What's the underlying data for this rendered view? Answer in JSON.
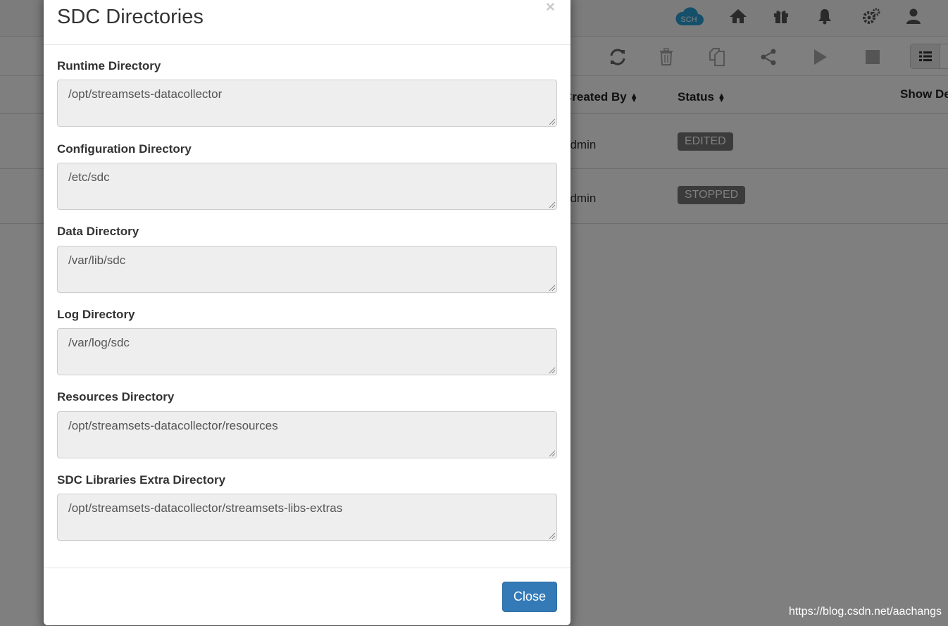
{
  "navbar": {
    "icons": [
      "sch-cloud-icon",
      "home-icon",
      "gift-icon",
      "bell-icon",
      "gears-icon",
      "user-icon"
    ],
    "sch_label": "SCH",
    "accent": "#2aa0d6"
  },
  "toolbar": {
    "icons": [
      "refresh-icon",
      "trash-icon",
      "duplicate-icon",
      "share-icon",
      "play-icon",
      "stop-icon",
      "list-view-icon"
    ]
  },
  "table": {
    "headers": {
      "created_by": "Created By",
      "status": "Status",
      "show": "Show De"
    },
    "rows": [
      {
        "created_by": "admin",
        "status": "EDITED"
      },
      {
        "created_by": "admin",
        "status": "STOPPED"
      }
    ]
  },
  "modal": {
    "title": "SDC Directories",
    "close_symbol": "×",
    "fields": [
      {
        "label": "Runtime Directory",
        "value": "/opt/streamsets-datacollector"
      },
      {
        "label": "Configuration Directory",
        "value": "/etc/sdc"
      },
      {
        "label": "Data Directory",
        "value": "/var/lib/sdc"
      },
      {
        "label": "Log Directory",
        "value": "/var/log/sdc"
      },
      {
        "label": "Resources Directory",
        "value": "/opt/streamsets-datacollector/resources"
      },
      {
        "label": "SDC Libraries Extra Directory",
        "value": "/opt/streamsets-datacollector/streamsets-libs-extras"
      }
    ],
    "close_button": "Close",
    "primary_color": "#337ab7"
  },
  "watermark": "https://blog.csdn.net/aachangs"
}
